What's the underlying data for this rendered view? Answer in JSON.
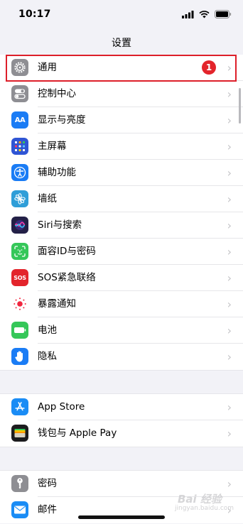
{
  "status_bar": {
    "time": "10:17",
    "icons": [
      "signal-bars-icon",
      "wifi-icon",
      "battery-icon"
    ]
  },
  "nav": {
    "title": "设置"
  },
  "groups": [
    {
      "items": [
        {
          "label": "通用",
          "icon": "gear-icon",
          "color": "#8e8e93",
          "badge": "1",
          "highlighted": true
        },
        {
          "label": "控制中心",
          "icon": "toggles-icon",
          "color": "#8e8e93"
        },
        {
          "label": "显示与亮度",
          "icon": "aa-icon",
          "color": "#1a7cf5",
          "glyph": "AA"
        },
        {
          "label": "主屏幕",
          "icon": "home-grid-icon",
          "color": "#2f55d4"
        },
        {
          "label": "辅助功能",
          "icon": "accessibility-icon",
          "color": "#1a7cf5"
        },
        {
          "label": "墙纸",
          "icon": "wallpaper-flower-icon",
          "color": "#2f9ed8"
        },
        {
          "label": "Siri与搜索",
          "icon": "siri-icon",
          "color": "#232047"
        },
        {
          "label": "面容ID与密码",
          "icon": "face-id-icon",
          "color": "#35c759"
        },
        {
          "label": "SOS紧急联络",
          "icon": "sos-icon",
          "color": "#e3242b",
          "glyph": "SOS"
        },
        {
          "label": "暴露通知",
          "icon": "exposure-notification-icon",
          "color": "#ffffff"
        },
        {
          "label": "电池",
          "icon": "battery-app-icon",
          "color": "#35c759"
        },
        {
          "label": "隐私",
          "icon": "hand-icon",
          "color": "#1a7cf5"
        }
      ]
    },
    {
      "items": [
        {
          "label": "App Store",
          "icon": "app-store-icon",
          "color": "#1a8cf5"
        },
        {
          "label": "钱包与 Apple Pay",
          "icon": "wallet-icon",
          "color": "#1c1c1e"
        }
      ]
    },
    {
      "items": [
        {
          "label": "密码",
          "icon": "key-icon",
          "color": "#8e8e93"
        },
        {
          "label": "邮件",
          "icon": "mail-icon",
          "color": "#1a8cf5"
        }
      ]
    }
  ],
  "watermark": {
    "line1": "Bai 经验",
    "line2": "jingyan.baidu.com"
  }
}
